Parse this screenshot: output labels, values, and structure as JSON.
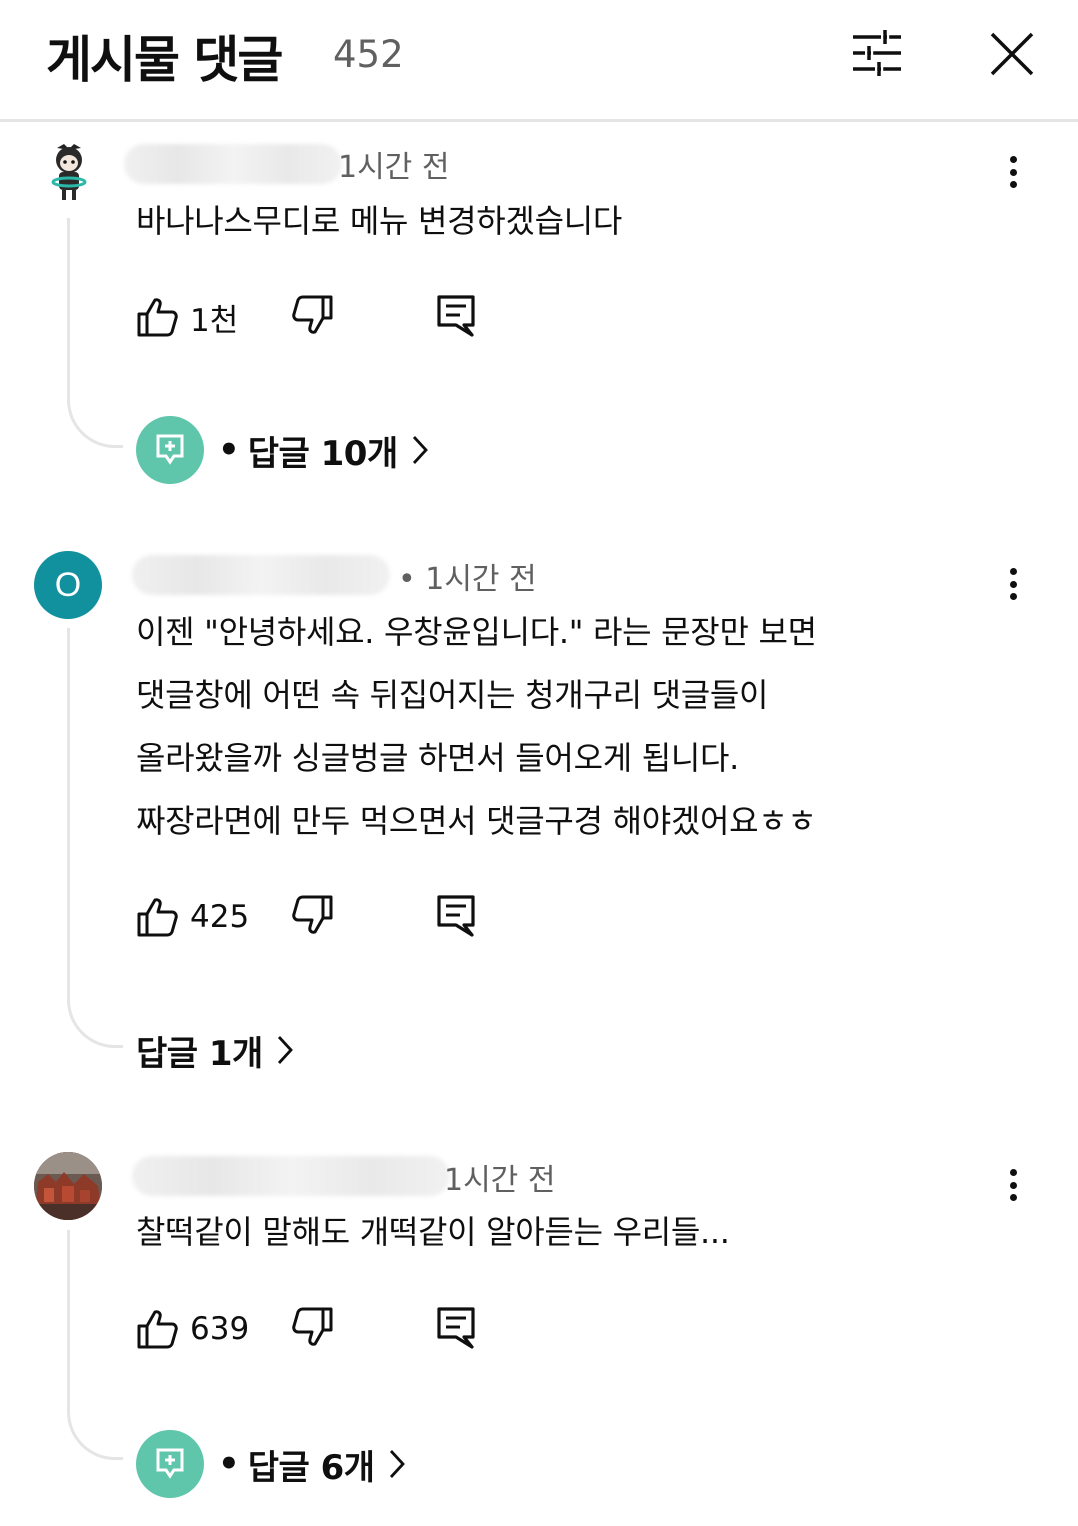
{
  "header": {
    "title": "게시물 댓글",
    "count": "452"
  },
  "comments": [
    {
      "avatar": "character-avatar",
      "time": "1시간 전",
      "text_lines": [
        "바나나스무디로 메뉴 변경하겠습니다"
      ],
      "likes": "1천",
      "replies_label": "답글 10개",
      "replies_bullet": "•"
    },
    {
      "avatar_letter": "O",
      "time": "• 1시간 전",
      "text_lines": [
        "이젠 \"안녕하세요. 우창윤입니다.\" 라는 문장만 보면",
        "댓글창에 어떤 속 뒤집어지는 청개구리 댓글들이",
        "올라왔을까 싱글벙글 하면서 들어오게 됩니다.",
        "짜장라면에 만두 먹으면서 댓글구경 해야겠어요ㅎㅎ"
      ],
      "likes": "425",
      "replies_label": "답글 1개"
    },
    {
      "avatar": "photo-avatar",
      "time": "1시간 전",
      "text_lines": [
        "찰떡같이 말해도 개떡같이 알아듣는 우리들..."
      ],
      "likes": "639",
      "replies_label": "답글 6개",
      "replies_bullet": "•"
    }
  ],
  "colors": {
    "accent_teal": "#11919d",
    "reply_avatar": "#5fc6ac",
    "text": "#0f0f0f",
    "meta": "#606060",
    "divider": "#e5e5e5"
  }
}
